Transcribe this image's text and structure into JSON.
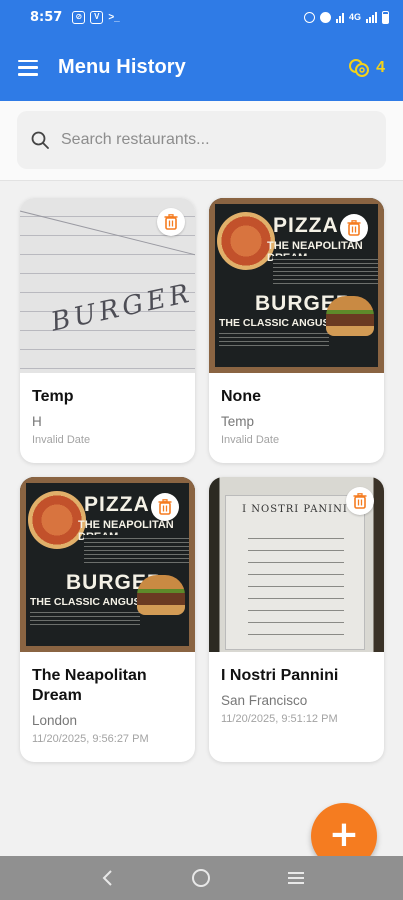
{
  "status_bar": {
    "time": "8:57",
    "network": "4G",
    "colors": {
      "background": "#2f7be6"
    }
  },
  "app_bar": {
    "title": "Menu History",
    "credits_count": "4",
    "icons": {
      "menu": "hamburger-menu-icon",
      "credits": "coins-icon"
    }
  },
  "search": {
    "placeholder": "Search restaurants...",
    "value": ""
  },
  "cards": [
    {
      "title": "Temp",
      "location": "H",
      "date": "Invalid Date",
      "image": "handwritten-burger-note"
    },
    {
      "title": "None",
      "location": "Temp",
      "date": "Invalid Date",
      "image": "pizza-burger-chalkboard"
    },
    {
      "title": "The Neapolitan Dream",
      "location": "London",
      "date": "11/20/2025, 9:56:27 PM",
      "image": "pizza-burger-chalkboard"
    },
    {
      "title": "I Nostri Pannini",
      "location": "San Francisco",
      "date": "11/20/2025, 9:51:12 PM",
      "image": "paper-menu-photo"
    }
  ],
  "board_image_text": {
    "pizza": "PIZZA",
    "pizza_sub": "THE NEAPOLITAN DREAM",
    "burger": "BURGER",
    "burger_sub": "THE CLASSIC ANGUS SMASH"
  },
  "paper_image_text": {
    "scribble": "BURGER"
  },
  "menu_image_text": {
    "heading": "I NOSTRI PANINI"
  },
  "fab": {
    "label": "+"
  },
  "theme": {
    "primary": "#2f7be6",
    "accent": "#f57c20",
    "credits": "#f3d21a",
    "delete": "#f57c20"
  }
}
